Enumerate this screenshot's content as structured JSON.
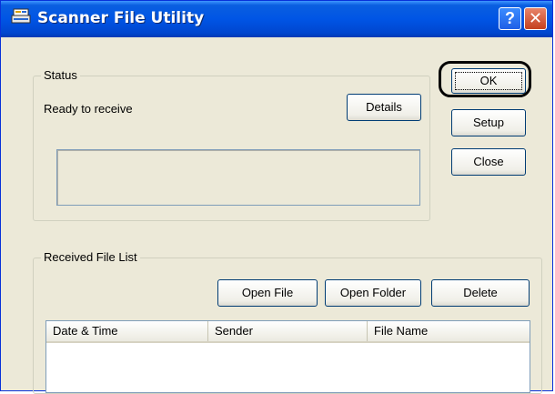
{
  "window": {
    "title": "Scanner File Utility",
    "help_label": "?",
    "close_label": "✕"
  },
  "status": {
    "label": "Status",
    "message": "Ready to receive",
    "details_button": "Details"
  },
  "buttons": {
    "ok": "OK",
    "setup": "Setup",
    "close": "Close"
  },
  "received": {
    "label": "Received File List",
    "open_file": "Open File",
    "open_folder": "Open Folder",
    "delete": "Delete",
    "columns": [
      "Date & Time",
      "Sender",
      "File Name"
    ]
  },
  "icons": {
    "app": "scanner-icon",
    "help": "help-icon",
    "close": "close-icon"
  },
  "colors": {
    "titlebar": "#0055e5",
    "window_bg": "#ece9d8",
    "close_btn": "#c4401e"
  }
}
